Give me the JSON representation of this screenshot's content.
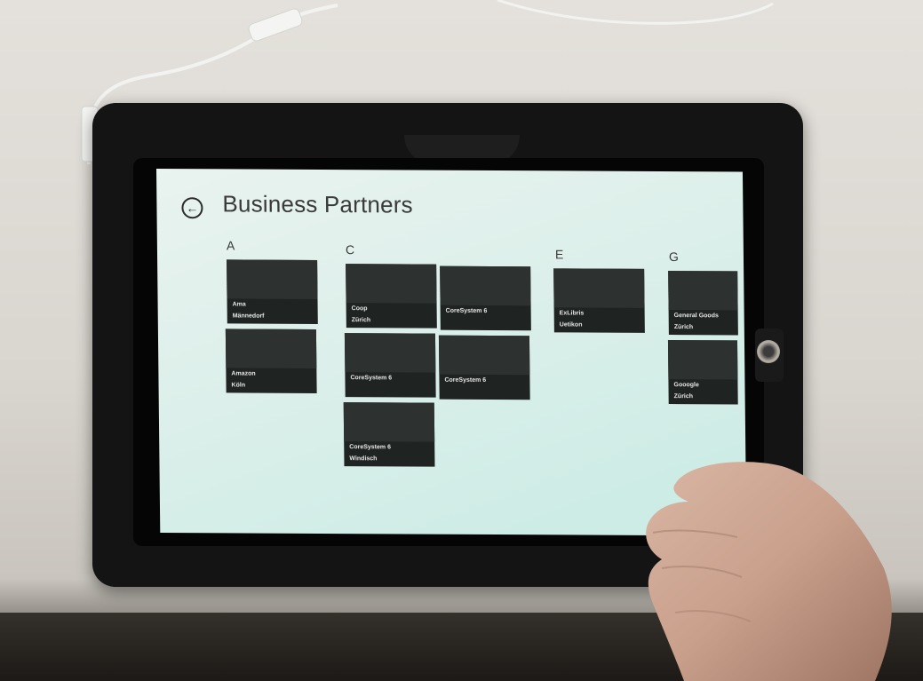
{
  "screen": {
    "title": "Business Partners",
    "back_icon": "←",
    "groups": [
      {
        "letter": "A",
        "tiles": [
          {
            "name": "Ama",
            "city": "Männedorf"
          },
          {
            "name": "Amazon",
            "city": "Köln"
          }
        ]
      },
      {
        "letter": "C",
        "tiles": [
          {
            "name": "Coop",
            "city": "Zürich"
          },
          {
            "name": "CoreSystem 6",
            "city": ""
          },
          {
            "name": "CoreSystem 6",
            "city": ""
          },
          {
            "name": "CoreSystem 6",
            "city": ""
          },
          {
            "name": "CoreSystem 6",
            "city": "Windisch"
          }
        ]
      },
      {
        "letter": "E",
        "tiles": [
          {
            "name": "ExLibris",
            "city": "Uetikon"
          }
        ]
      },
      {
        "letter": "G",
        "tiles": [
          {
            "name": "General Goods",
            "city": "Zürich"
          },
          {
            "name": "Gooogle",
            "city": "Zürich"
          }
        ]
      }
    ]
  },
  "colors": {
    "screen_bg": "#dcefea",
    "tile_bg": "#1f2322",
    "title_text": "#3a3a3a"
  }
}
